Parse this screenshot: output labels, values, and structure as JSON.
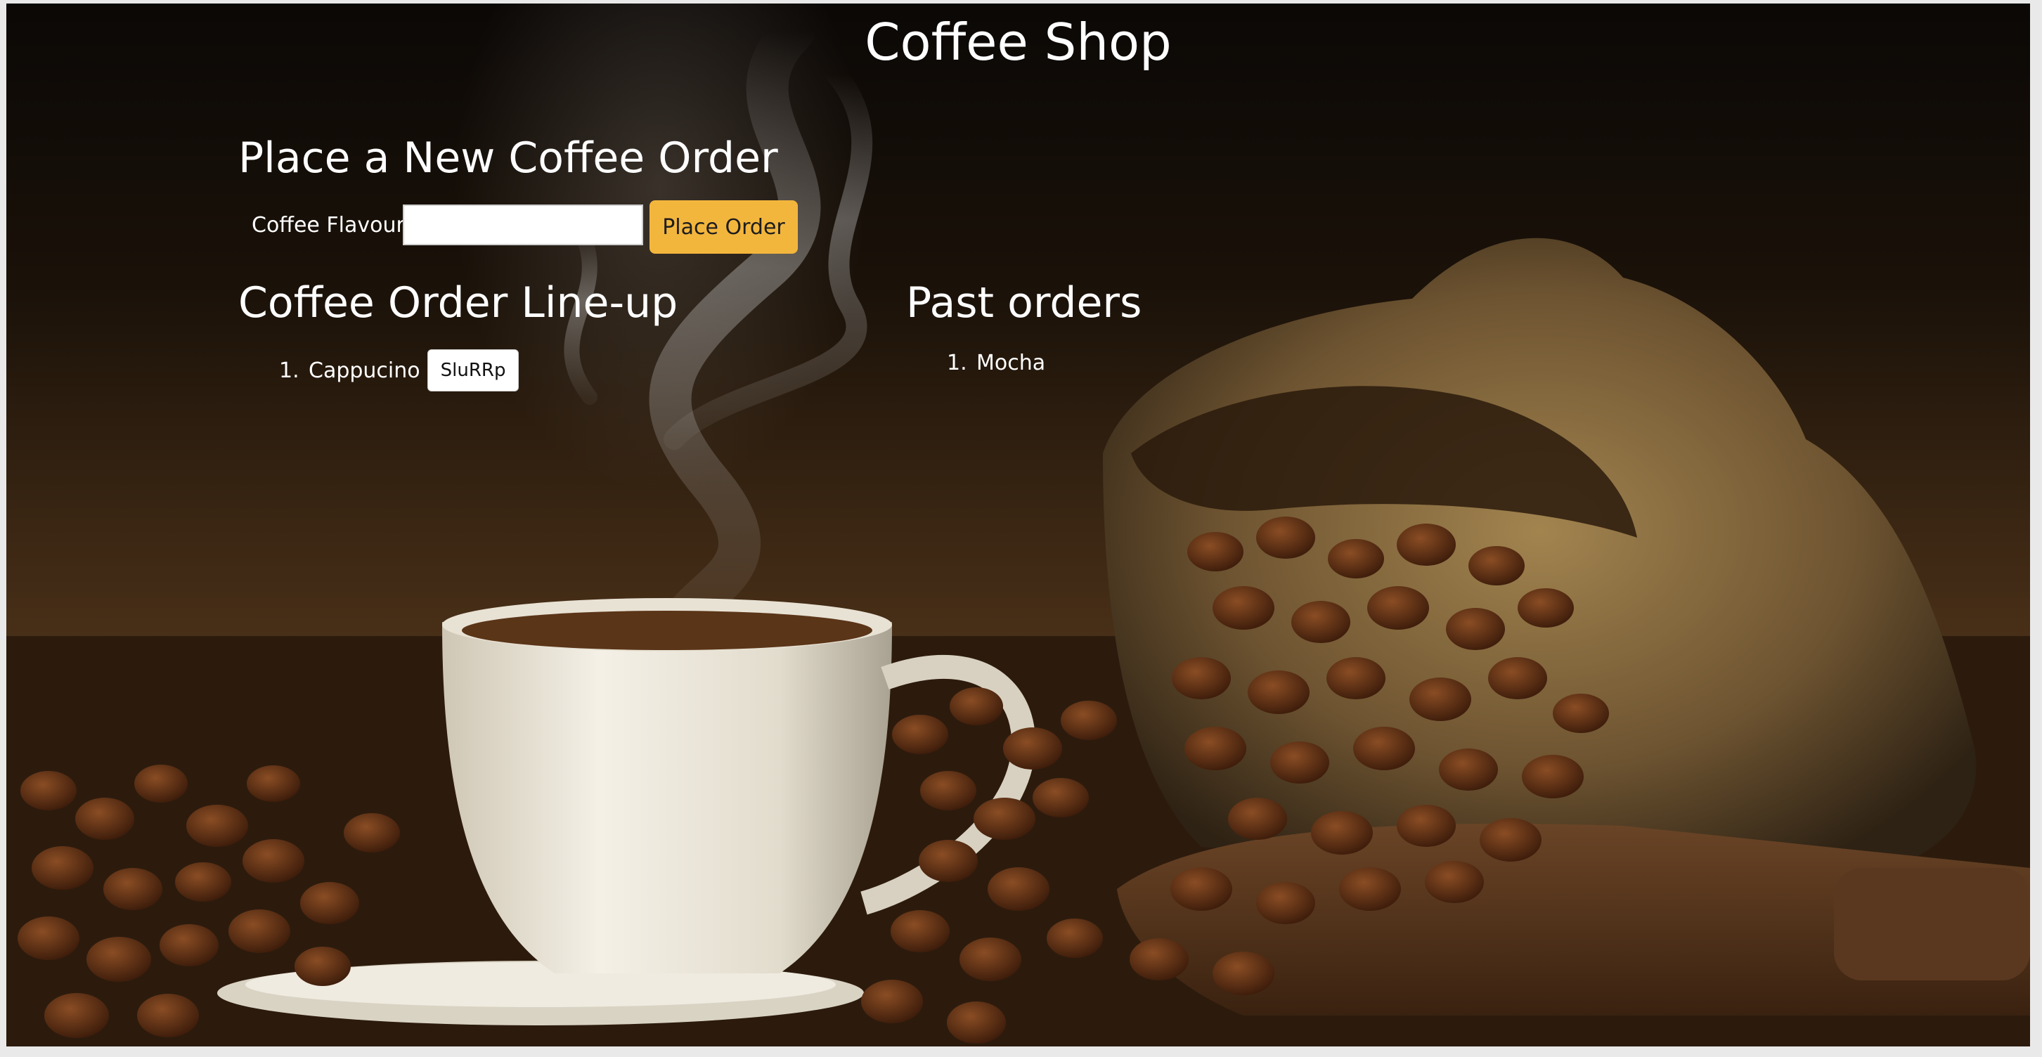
{
  "header": {
    "title": "Coffee Shop"
  },
  "order_form": {
    "heading": "Place a New Coffee Order",
    "flavour_label": "Coffee Flavour:",
    "flavour_value": "",
    "submit_label": "Place Order"
  },
  "lineup": {
    "heading": "Coffee Order Line-up",
    "items": [
      {
        "number": "1.",
        "name": "Cappucino",
        "action_label": "SluRRp"
      }
    ]
  },
  "past_orders": {
    "heading": "Past orders",
    "items": [
      {
        "number": "1.",
        "name": "Mocha"
      }
    ]
  },
  "colors": {
    "accent_button": "#f3b63d",
    "text": "#ffffff"
  }
}
